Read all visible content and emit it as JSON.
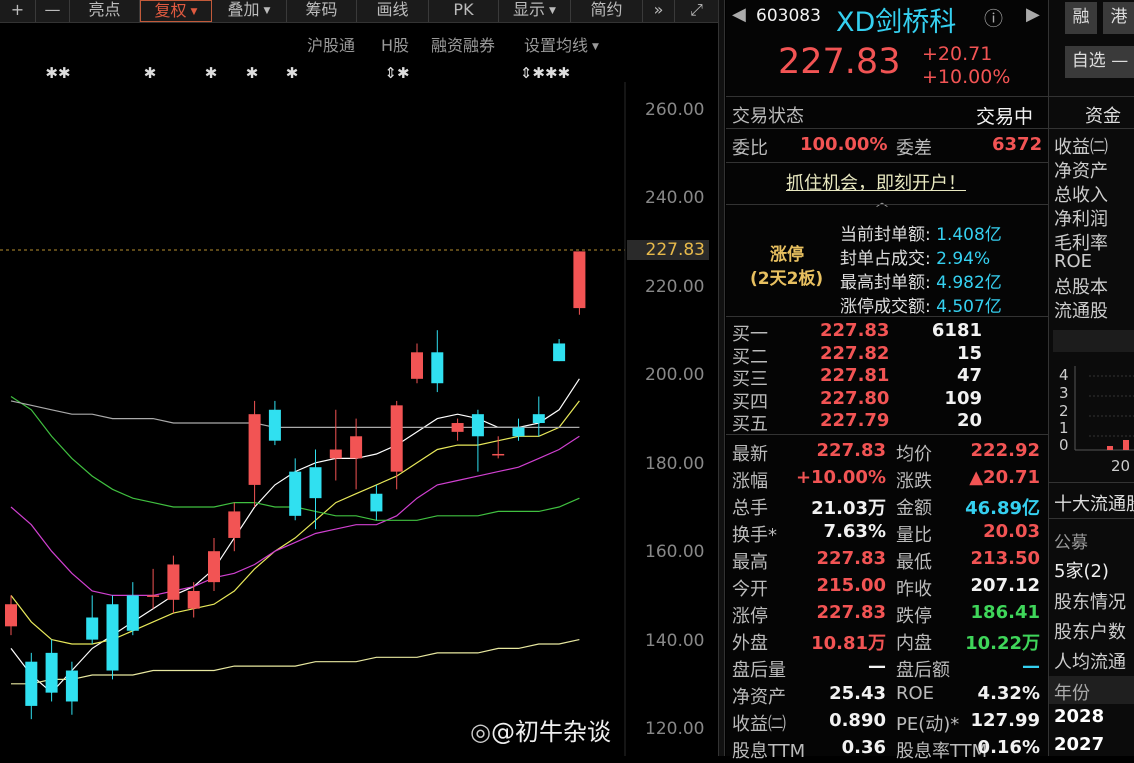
{
  "toolbar": {
    "plus": "+",
    "minus": "—",
    "buttons": [
      "亮点",
      "复权",
      "叠加",
      "筹码",
      "画线",
      "PK",
      "显示",
      "简约"
    ],
    "fast_forward": "»",
    "expand": "⤢"
  },
  "sub_toolbar": {
    "links": [
      "沪股通",
      "H股",
      "融资融券",
      "设置均线"
    ]
  },
  "chart_data": {
    "type": "candlestick",
    "y_ticks": [
      "260.00",
      "240.00",
      "227.83",
      "220.00",
      "200.00",
      "180.00",
      "160.00",
      "140.00",
      "120.00"
    ],
    "last_price_label": "227.83",
    "ylim": [
      120,
      262
    ],
    "markers": [
      "✱✱",
      "✱",
      "✱",
      "✱",
      "✱",
      "⇕✱",
      "⇕✱✱✱"
    ],
    "candles": [
      {
        "o": 143,
        "c": 148,
        "h": 150,
        "l": 141
      },
      {
        "o": 135,
        "c": 125,
        "h": 137,
        "l": 122
      },
      {
        "o": 137,
        "c": 128,
        "h": 140,
        "l": 126
      },
      {
        "o": 133,
        "c": 126,
        "h": 135,
        "l": 123
      },
      {
        "o": 145,
        "c": 140,
        "h": 150,
        "l": 139
      },
      {
        "o": 148,
        "c": 133,
        "h": 150,
        "l": 131
      },
      {
        "o": 150,
        "c": 142,
        "h": 153,
        "l": 141
      },
      {
        "o": 150,
        "c": 150,
        "h": 156,
        "l": 147
      },
      {
        "o": 149,
        "c": 157,
        "h": 159,
        "l": 146
      },
      {
        "o": 147,
        "c": 151,
        "h": 153,
        "l": 145
      },
      {
        "o": 153,
        "c": 160,
        "h": 163,
        "l": 151
      },
      {
        "o": 163,
        "c": 169,
        "h": 171,
        "l": 160
      },
      {
        "o": 175,
        "c": 191,
        "h": 194,
        "l": 170
      },
      {
        "o": 192,
        "c": 185,
        "h": 194,
        "l": 184
      },
      {
        "o": 178,
        "c": 168,
        "h": 181,
        "l": 167
      },
      {
        "o": 179,
        "c": 172,
        "h": 183,
        "l": 165
      },
      {
        "o": 181,
        "c": 183,
        "h": 192,
        "l": 176
      },
      {
        "o": 181,
        "c": 186,
        "h": 190,
        "l": 174
      },
      {
        "o": 173,
        "c": 169,
        "h": 175,
        "l": 167
      },
      {
        "o": 178,
        "c": 193,
        "h": 194,
        "l": 174
      },
      {
        "o": 199,
        "c": 205,
        "h": 207,
        "l": 198
      },
      {
        "o": 205,
        "c": 198,
        "h": 210,
        "l": 196
      },
      {
        "o": 187,
        "c": 189,
        "h": 190,
        "l": 185
      },
      {
        "o": 191,
        "c": 186,
        "h": 192,
        "l": 178
      },
      {
        "o": 182,
        "c": 182,
        "h": 186,
        "l": 181
      },
      {
        "o": 188,
        "c": 186,
        "h": 190,
        "l": 185
      },
      {
        "o": 191,
        "c": 189,
        "h": 195,
        "l": 186
      },
      {
        "o": 207,
        "c": 203,
        "h": 208,
        "l": 203
      },
      {
        "o": 215,
        "c": 227.83,
        "h": 227.83,
        "l": 213.5
      }
    ],
    "ma_lines": [
      {
        "color": "#ffffff",
        "values": [
          138,
          132,
          128,
          133,
          138,
          141,
          144,
          147,
          150,
          152,
          156,
          163,
          170,
          175,
          178,
          180,
          181,
          181,
          182,
          184,
          187,
          190,
          191,
          190,
          188,
          188,
          189,
          192,
          199
        ]
      },
      {
        "color": "#e8e85a",
        "values": [
          150,
          144,
          140,
          139,
          139,
          140,
          142,
          144,
          146,
          147,
          148,
          151,
          156,
          160,
          163,
          167,
          171,
          173,
          175,
          177,
          180,
          183,
          184,
          184,
          185,
          186,
          186,
          188,
          194
        ]
      },
      {
        "color": "#d040d0",
        "values": [
          170,
          166,
          160,
          155,
          151,
          150,
          150,
          150,
          151,
          152,
          154,
          155,
          157,
          160,
          162,
          164,
          165,
          166,
          166,
          168,
          172,
          175,
          176,
          177,
          178,
          179,
          181,
          183,
          186
        ]
      },
      {
        "color": "#40c040",
        "values": [
          195,
          192,
          186,
          181,
          177,
          174,
          172,
          171,
          170,
          170,
          170,
          171,
          171,
          170,
          170,
          169,
          168,
          168,
          167,
          167,
          167,
          168,
          168,
          168,
          169,
          169,
          169,
          170,
          172
        ]
      },
      {
        "color": "#aaaaaa",
        "values": [
          194,
          193,
          192,
          191,
          191,
          190,
          190,
          190,
          189,
          189,
          189,
          189,
          189,
          188,
          188,
          188,
          188,
          188,
          188,
          188,
          188,
          188,
          188,
          188,
          188,
          188,
          188,
          188,
          188
        ]
      },
      {
        "color": "#e8e8a0",
        "values": [
          130,
          130,
          131,
          131,
          132,
          132,
          132,
          133,
          133,
          133,
          133,
          134,
          134,
          134,
          134,
          135,
          135,
          135,
          136,
          136,
          136,
          137,
          137,
          137,
          138,
          138,
          139,
          139,
          140
        ]
      }
    ]
  },
  "watermark": "@初牛杂谈",
  "quote": {
    "code": "603083",
    "name": "XD剑桥科",
    "price": "227.83",
    "change": "+20.71",
    "change_pct": "+10.00%",
    "trade_status_label": "交易状态",
    "trade_status": "交易中",
    "weibi_label": "委比",
    "weibi": "100.00%",
    "weicha_label": "委差",
    "weicha": "6372",
    "open_account": "抓住机会，即刻开户！",
    "limit_up_title": "涨停",
    "limit_up_days": "(2天2板)",
    "seal_info": [
      {
        "label": "当前封单额:",
        "value": "1.408亿"
      },
      {
        "label": "封单占成交:",
        "value": "2.94%"
      },
      {
        "label": "最高封单额:",
        "value": "4.982亿"
      },
      {
        "label": "涨停成交额:",
        "value": "4.507亿"
      }
    ],
    "bids": [
      {
        "label": "买一",
        "price": "227.83",
        "vol": "6181"
      },
      {
        "label": "买二",
        "price": "227.82",
        "vol": "15"
      },
      {
        "label": "买三",
        "price": "227.81",
        "vol": "47"
      },
      {
        "label": "买四",
        "price": "227.80",
        "vol": "109"
      },
      {
        "label": "买五",
        "price": "227.79",
        "vol": "20"
      }
    ],
    "stats": [
      {
        "l1": "最新",
        "v1": "227.83",
        "c1": "red",
        "l2": "均价",
        "v2": "222.92",
        "c2": "red"
      },
      {
        "l1": "涨幅",
        "v1": "+10.00%",
        "c1": "red",
        "l2": "涨跌",
        "v2": "▲20.71",
        "c2": "red"
      },
      {
        "l1": "总手",
        "v1": "21.03万",
        "c1": "white",
        "l2": "金额",
        "v2": "46.89亿",
        "c2": "cyan"
      },
      {
        "l1": "换手*",
        "v1": "7.63%",
        "c1": "white",
        "l2": "量比",
        "v2": "20.03",
        "c2": "red"
      },
      {
        "l1": "最高",
        "v1": "227.83",
        "c1": "red",
        "l2": "最低",
        "v2": "213.50",
        "c2": "red"
      },
      {
        "l1": "今开",
        "v1": "215.00",
        "c1": "red",
        "l2": "昨收",
        "v2": "207.12",
        "c2": "white"
      },
      {
        "l1": "涨停",
        "v1": "227.83",
        "c1": "red",
        "l2": "跌停",
        "v2": "186.41",
        "c2": "green"
      },
      {
        "l1": "外盘",
        "v1": "10.81万",
        "c1": "red",
        "l2": "内盘",
        "v2": "10.22万",
        "c2": "green"
      },
      {
        "l1": "盘后量",
        "v1": "—",
        "c1": "white",
        "l2": "盘后额",
        "v2": "—",
        "c2": "cyan"
      },
      {
        "l1": "净资产",
        "v1": "25.43",
        "c1": "white",
        "l2": "ROE",
        "v2": "4.32%",
        "c2": "white"
      },
      {
        "l1": "收益㈡",
        "v1": "0.890",
        "c1": "white",
        "l2": "PE(动)*",
        "v2": "127.99",
        "c2": "white"
      },
      {
        "l1": "股息TTM",
        "v1": "0.36",
        "c1": "white",
        "l2": "股息率TTM",
        "v2": "0.16%",
        "c2": "white"
      }
    ]
  },
  "right_panel": {
    "btn_rong": "融",
    "btn_gang": "港",
    "btn_zixuan": "自选 —",
    "tab_zijin": "资金",
    "items": [
      "收益㈡",
      "净资产",
      "总收入",
      "净利润",
      "毛利率",
      "ROE",
      "总股本",
      "流通股"
    ],
    "mini_axis": [
      "4",
      "3",
      "2",
      "1",
      "0"
    ],
    "mini_xlabel": "20",
    "top10_title": "十大流通股",
    "gongmu": "公募",
    "jia": "5家(2)",
    "holder_links": [
      "股东情况",
      "股东户数",
      "人均流通"
    ],
    "year_title": "年份",
    "years": [
      "2028",
      "2027"
    ]
  }
}
